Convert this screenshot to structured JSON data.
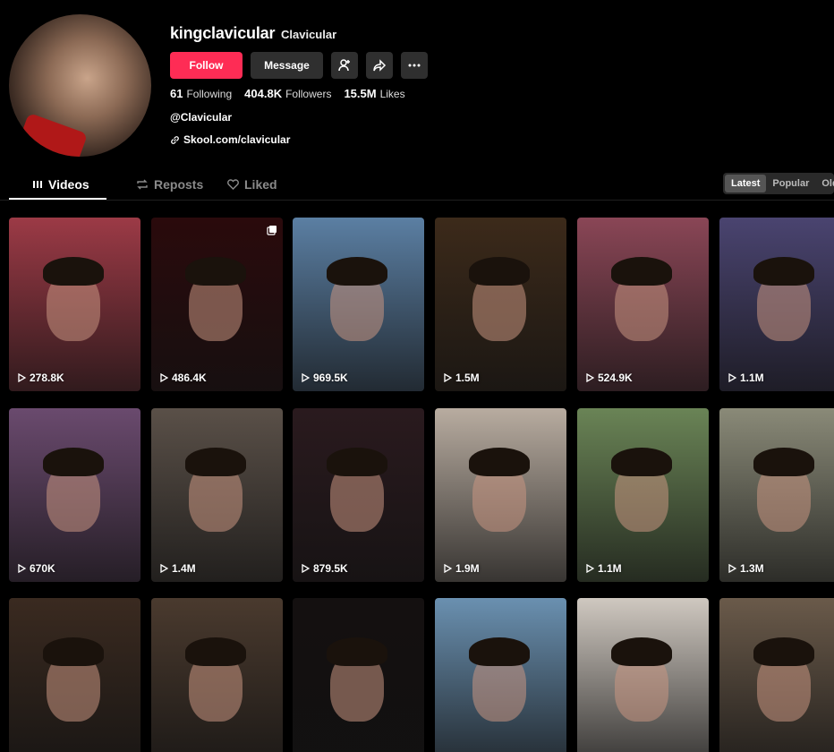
{
  "profile": {
    "username": "kingclavicular",
    "nickname": "Clavicular",
    "handle": "@Clavicular",
    "link": "Skool.com/clavicular",
    "follow_label": "Follow",
    "message_label": "Message",
    "stats": [
      {
        "num": "61",
        "label": "Following"
      },
      {
        "num": "404.8K",
        "label": "Followers"
      },
      {
        "num": "15.5M",
        "label": "Likes"
      }
    ]
  },
  "tabs": [
    {
      "label": "Videos",
      "icon": "grid-icon",
      "active": true
    },
    {
      "label": "Reposts",
      "icon": "repost-icon",
      "active": false
    },
    {
      "label": "Liked",
      "icon": "heart-icon",
      "active": false
    }
  ],
  "sort": [
    "Latest",
    "Popular",
    "Oldest"
  ],
  "videos": [
    {
      "views": "278.8K",
      "bg": "#9c3a46"
    },
    {
      "views": "486.4K",
      "bg": "#2a0a0c"
    },
    {
      "views": "969.5K",
      "bg": "#5b7fa3"
    },
    {
      "views": "1.5M",
      "bg": "#3c2a1a"
    },
    {
      "views": "524.9K",
      "bg": "#8a4656"
    },
    {
      "views": "1.1M",
      "bg": "#4a4470"
    },
    {
      "views": "670K",
      "bg": "#6a4a6e"
    },
    {
      "views": "1.4M",
      "bg": "#5a5048"
    },
    {
      "views": "879.5K",
      "bg": "#2a1a1e"
    },
    {
      "views": "1.9M",
      "bg": "#b8aca0"
    },
    {
      "views": "1.1M",
      "bg": "#6a8456"
    },
    {
      "views": "1.3M",
      "bg": "#8a8a78"
    },
    {
      "views": "",
      "bg": "#3a2a20"
    },
    {
      "views": "",
      "bg": "#4a3a2e"
    },
    {
      "views": "",
      "bg": "#141010"
    },
    {
      "views": "",
      "bg": "#6a90b0"
    },
    {
      "views": "",
      "bg": "#cfc8c0"
    },
    {
      "views": "",
      "bg": "#6a5a4a"
    }
  ]
}
